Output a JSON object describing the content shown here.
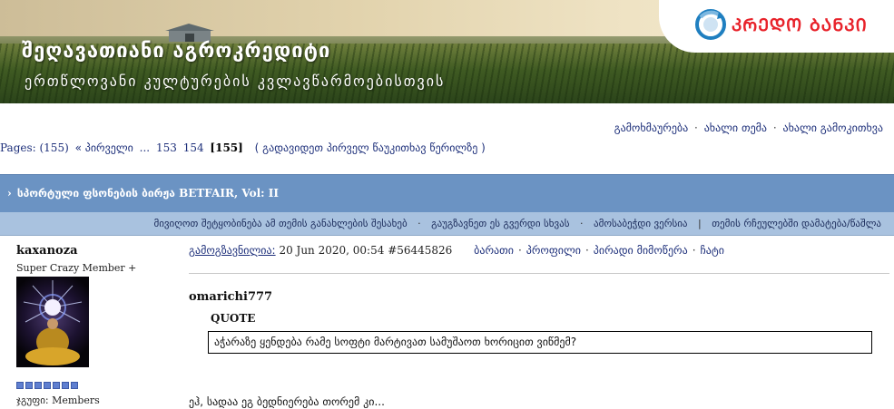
{
  "banner": {
    "title_line1": "შეღავათიანი აგროკრედიტი",
    "title_line2": "ერთწლოვანი კულტურების კვლავწარმოებისთვის",
    "logo_text": "ᲙᲠᲔᲓᲝ ᲑᲐᲜᲙᲘ",
    "logo_color": "#e8232b"
  },
  "top_links": {
    "reply": "გამოხმაურება",
    "new_topic": "ახალი თემა",
    "new_poll": "ახალი გამოკითხვა",
    "separator": "·"
  },
  "pagination": {
    "prefix": "Pages: (155)",
    "first": "« პირველი",
    "ellipsis": "...",
    "pages": [
      "153",
      "154"
    ],
    "current": "[155]",
    "goto_first_unread": "( გადავიდეთ პირველ წაუკითხავ წერილზე )"
  },
  "topic": {
    "arrow": "›",
    "title_geo": "სპორტული ფსონების ბირჟა",
    "title_en": "BETFAIR, Vol: II"
  },
  "topic_options": {
    "track": "მივიღოთ შეტყობინება ამ თემის განახლების შესახებ",
    "send": "გაუგზავნეთ ეს გვერდი სხვას",
    "print": "ამოსაბეჭდი ვერსია",
    "favorite": "თემის რჩეულებში დამატება/წაშლა"
  },
  "post": {
    "author": "kaxanoza",
    "rank": "Super Crazy Member +",
    "pips_count": 7,
    "group_label": "ჯგუფი:",
    "group_value": "Members",
    "sent_label": "გამოგზავნილია:",
    "date": "20 Jun 2020, 00:54",
    "post_id": "#56445826",
    "links": [
      "ბარათი",
      "პროფილი",
      "პირადი მიმოწერა",
      "ჩატი"
    ],
    "quoted_author": "omarichi777",
    "quote_label": "QUOTE",
    "quote_text": "აჭარაზე ყენდება რამე სოფტი მარტივათ სამუშაოთ ხორიცით ვიწმემ?",
    "body_text": "ეჰ, სადაა ეგ ბედნიერება თორემ კი..."
  },
  "colors": {
    "header_blue": "#6b93c3",
    "options_blue": "#a9c2df",
    "link_blue": "#1d2f7a"
  }
}
